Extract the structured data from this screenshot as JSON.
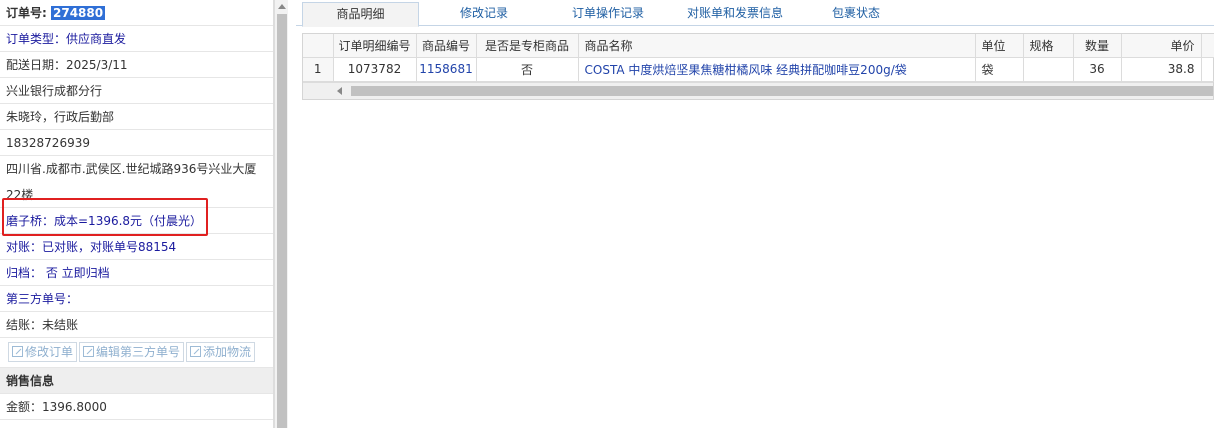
{
  "left": {
    "order_label": "订单号:",
    "order_no": "274880",
    "order_type": "订单类型：供应商直发",
    "delivery_date": "配送日期：2025/3/11",
    "bank": "兴业银行成都分行",
    "contact": "朱晓玲，行政后勤部",
    "phone": "18328726939",
    "address": "四川省.成都市.武侯区.世纪城路936号兴业大厦22楼",
    "cost_line": "磨子桥：成本=1396.8元（付晨光）",
    "reconcile": "对账：已对账，对账单号88154",
    "archive": "归档：  否 立即归档",
    "third_party": "第三方单号：",
    "settle": "结账：未结账",
    "buttons": [
      "修改订单",
      "编辑第三方单号",
      "添加物流"
    ],
    "sales_header": "销售信息",
    "amount": "金额：1396.8000"
  },
  "tabs": [
    "商品明细",
    "修改记录",
    "订单操作记录",
    "对账单和发票信息",
    "包裹状态"
  ],
  "table": {
    "headers": [
      "订单明细编号",
      "商品编号",
      "是否是专柜商品",
      "商品名称",
      "单位",
      "规格",
      "数量",
      "单价"
    ],
    "rows": [
      {
        "idx": "1",
        "detail_no": "1073782",
        "product_no": "1158681",
        "counter": "否",
        "name": "COSTA 中度烘焙坚果焦糖柑橘风味 经典拼配咖啡豆200g/袋",
        "unit": "袋",
        "spec": "",
        "qty": "36",
        "price": "38.8"
      }
    ]
  },
  "colors": {
    "highlight": "#2f6fd6",
    "red_box": "#e02020",
    "link": "#2244aa"
  }
}
